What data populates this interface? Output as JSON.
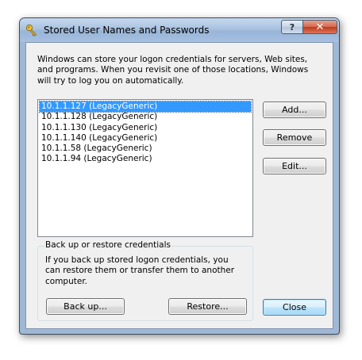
{
  "window": {
    "title": "Stored User Names and Passwords",
    "help_label": "?",
    "close_label": "✕"
  },
  "intro": {
    "text": "Windows can store your logon credentials for servers, Web sites, and programs. When you revisit one of those locations, Windows will try to log you on automatically."
  },
  "credentials": {
    "items": [
      "10.1.1.127 (LegacyGeneric)",
      "10.1.1.128 (LegacyGeneric)",
      "10.1.1.130 (LegacyGeneric)",
      "10.1.1.140 (LegacyGeneric)",
      "10.1.1.58 (LegacyGeneric)",
      "10.1.1.94 (LegacyGeneric)"
    ],
    "selected_index": 0
  },
  "actions": {
    "add_label": "Add...",
    "remove_label": "Remove",
    "edit_label": "Edit..."
  },
  "backup_group": {
    "title": "Back up or restore credentials",
    "text": "If you back up stored logon credentials, you can restore them or transfer them to another computer.",
    "backup_label": "Back up...",
    "restore_label": "Restore..."
  },
  "footer": {
    "close_label": "Close"
  },
  "colors": {
    "selection": "#3399ff",
    "title_glass": "#a9c2e0",
    "close_button": "#c0391b"
  },
  "icons": {
    "title_icon": "key-icon"
  }
}
